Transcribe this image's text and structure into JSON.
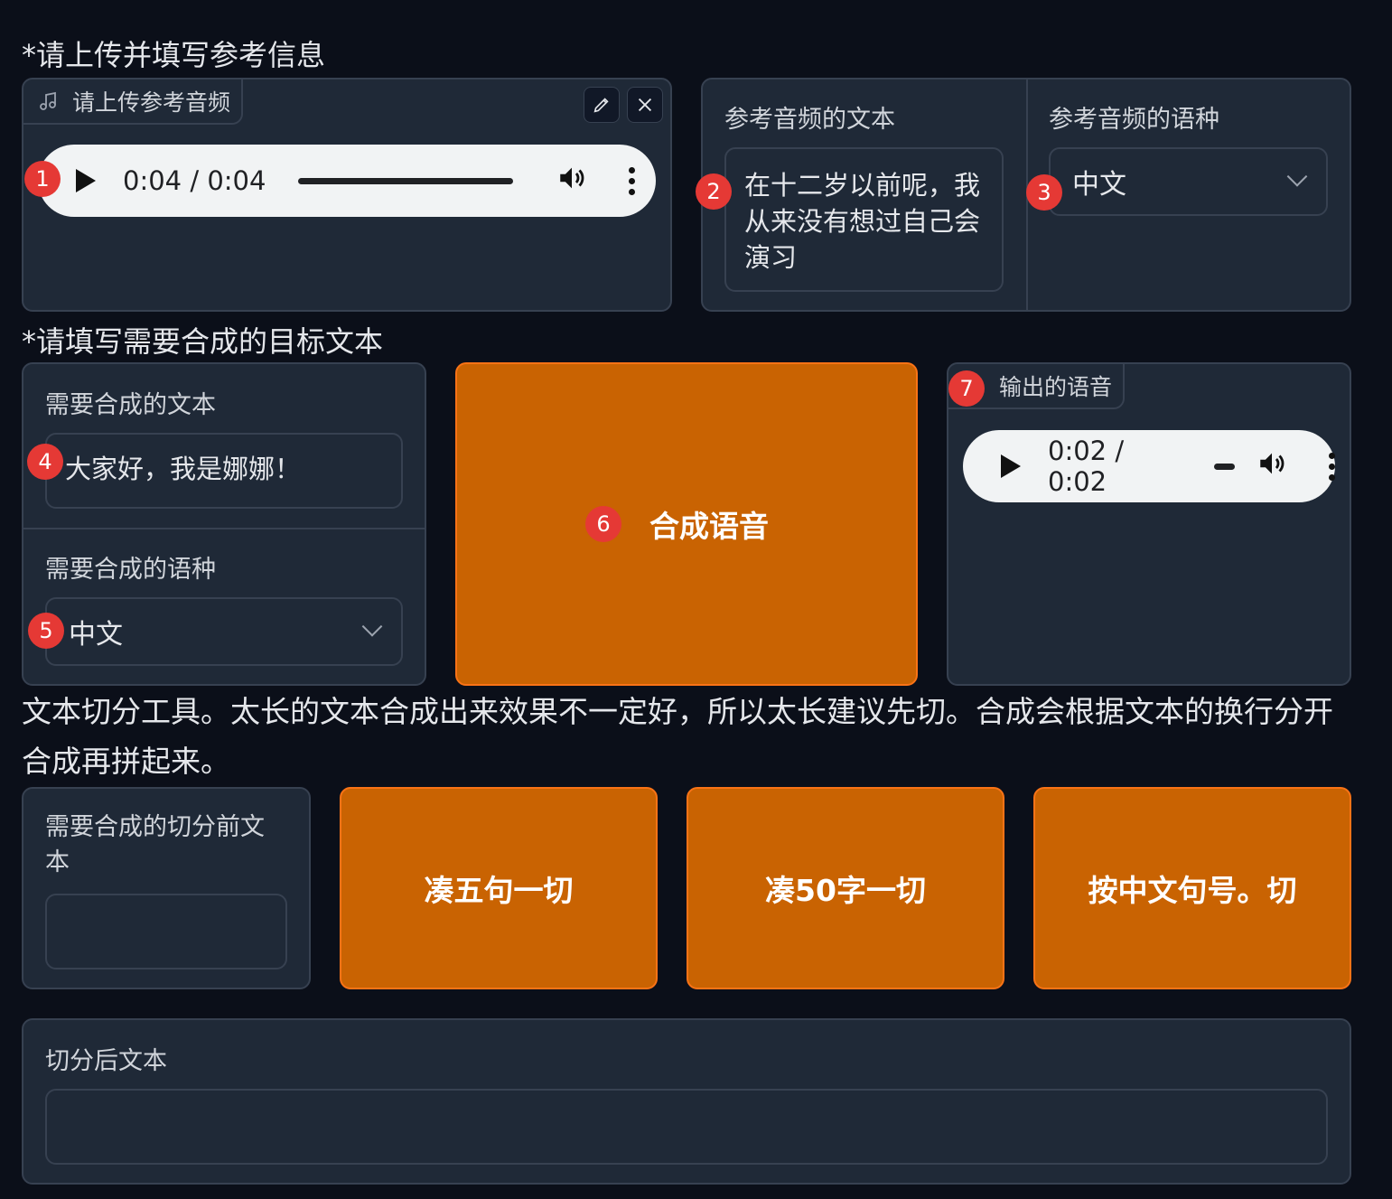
{
  "reference_section": {
    "heading": "*请上传并填写参考信息",
    "audio_upload": {
      "label": "请上传参考音频",
      "icon": "music-note-icon",
      "player_time": "0:04 / 0:04"
    },
    "reference_text": {
      "label": "参考音频的文本",
      "value": "在十二岁以前呢，我从来没有想过自己会演习"
    },
    "reference_language": {
      "label": "参考音频的语种",
      "value": "中文"
    }
  },
  "target_section": {
    "heading": "*请填写需要合成的目标文本",
    "target_text": {
      "label": "需要合成的文本",
      "value": "大家好，我是娜娜！"
    },
    "target_language": {
      "label": "需要合成的语种",
      "value": "中文"
    },
    "synthesize_button": "合成语音",
    "output_audio": {
      "label": "输出的语音",
      "player_time": "0:02 / 0:02"
    }
  },
  "split_section": {
    "description": "文本切分工具。太长的文本合成出来效果不一定好，所以太长建议先切。合成会根据文本的换行分开合成再拼起来。",
    "pre_split_text": {
      "label": "需要合成的切分前文本",
      "value": ""
    },
    "buttons": [
      "凑五句一切",
      "凑50字一切",
      "按中文句号。切"
    ],
    "post_split_text": {
      "label": "切分后文本",
      "value": ""
    }
  },
  "badges": [
    "1",
    "2",
    "3",
    "4",
    "5",
    "6",
    "7"
  ],
  "colors": {
    "background": "#0b0f19",
    "panel": "#1f2937",
    "border": "#374151",
    "accent_orange": "#c96302",
    "badge_red": "#e53935"
  }
}
